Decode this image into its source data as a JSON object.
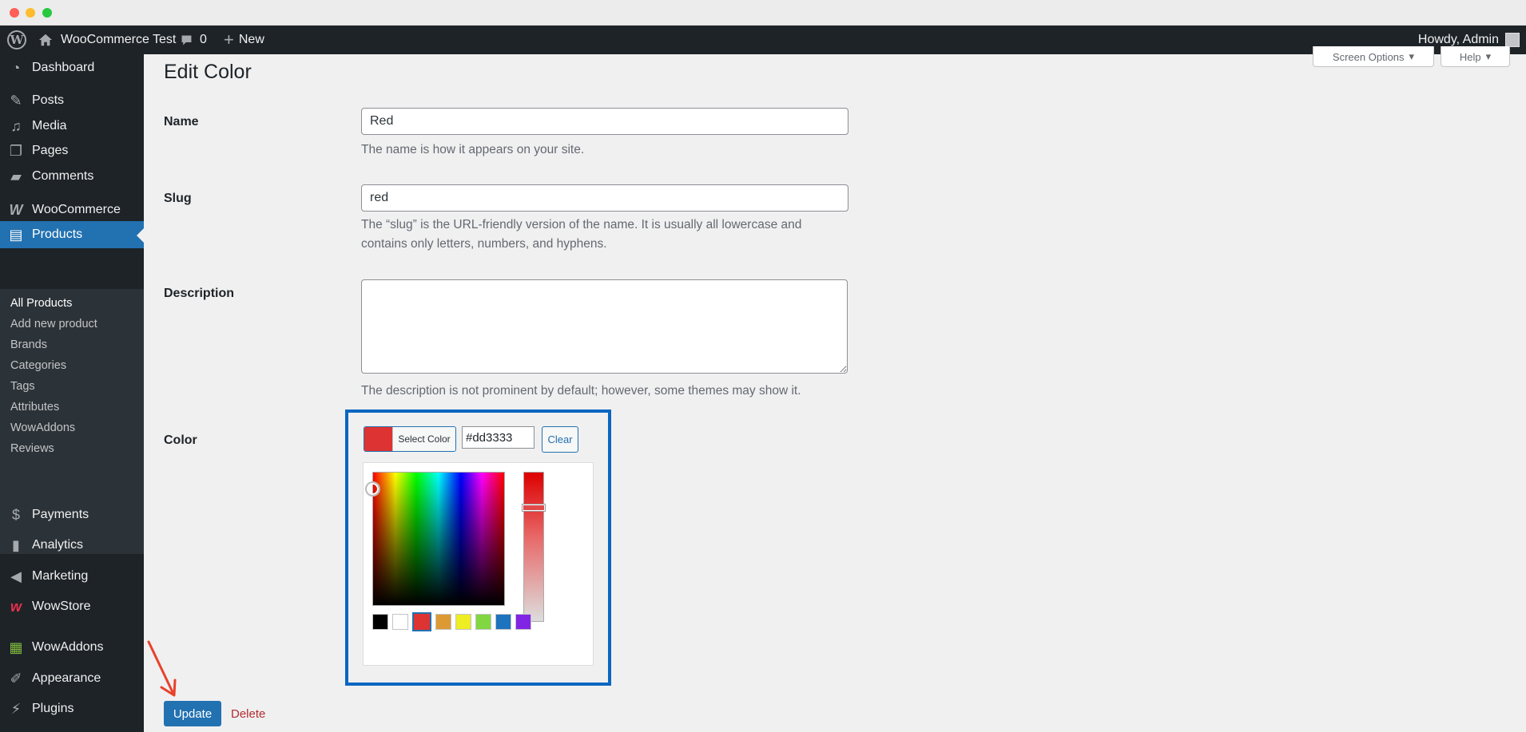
{
  "adminbar": {
    "site_name": "WooCommerce Test",
    "comments_count": "0",
    "new_label": "New",
    "howdy": "Howdy, Admin"
  },
  "sidebar": {
    "items": [
      {
        "label": "Dashboard",
        "icon": "dashboard-icon"
      },
      {
        "label": "Posts",
        "icon": "pushpin-icon"
      },
      {
        "label": "Media",
        "icon": "media-icon"
      },
      {
        "label": "Pages",
        "icon": "pages-icon"
      },
      {
        "label": "Comments",
        "icon": "comment-icon"
      },
      {
        "label": "WooCommerce",
        "icon": "woocommerce-icon"
      },
      {
        "label": "Products",
        "icon": "products-icon"
      },
      {
        "label": "Payments",
        "icon": "payments-icon"
      },
      {
        "label": "Analytics",
        "icon": "analytics-icon"
      },
      {
        "label": "Marketing",
        "icon": "marketing-icon"
      },
      {
        "label": "WowStore",
        "icon": "wowstore-icon"
      },
      {
        "label": "WowAddons",
        "icon": "wowaddons-icon"
      },
      {
        "label": "Appearance",
        "icon": "appearance-icon"
      },
      {
        "label": "Plugins",
        "icon": "plugins-icon"
      }
    ],
    "submenu": [
      "All Products",
      "Add new product",
      "Brands",
      "Categories",
      "Tags",
      "Attributes",
      "WowAddons",
      "Reviews"
    ]
  },
  "header": {
    "screen_options": "Screen Options",
    "help": "Help"
  },
  "page": {
    "title": "Edit Color"
  },
  "form": {
    "name_label": "Name",
    "name_value": "Red",
    "name_help": "The name is how it appears on your site.",
    "slug_label": "Slug",
    "slug_value": "red",
    "slug_help": "The “slug” is the URL-friendly version of the name. It is usually all lowercase and contains only letters, numbers, and hyphens.",
    "description_label": "Description",
    "description_value": "",
    "description_help": "The description is not prominent by default; however, some themes may show it.",
    "color_label": "Color"
  },
  "color_picker": {
    "select_label": "Select Color",
    "hex_value": "#dd3333",
    "clear_label": "Clear",
    "current_color": "#dd3333",
    "palette": [
      "#000000",
      "#ffffff",
      "#dd3333",
      "#dd9933",
      "#eeee22",
      "#81d742",
      "#1e73be",
      "#8224e3"
    ]
  },
  "actions": {
    "update_label": "Update",
    "delete_label": "Delete"
  },
  "colors": {
    "admin_dark": "#1d2327",
    "accent": "#2271b1",
    "highlight_frame": "#0a66c2",
    "annotation_arrow": "#e8412c"
  }
}
